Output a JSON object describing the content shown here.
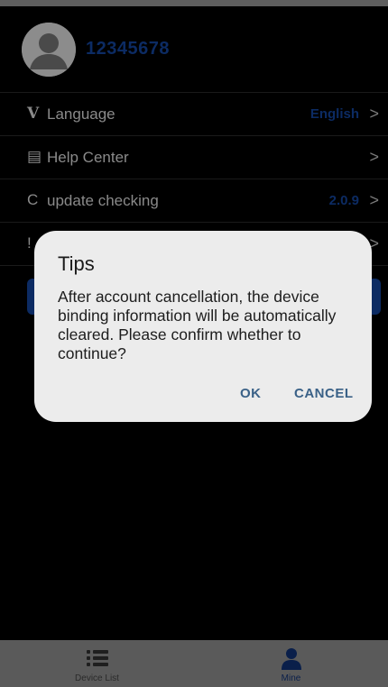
{
  "profile": {
    "username": "12345678"
  },
  "menu": [
    {
      "icon": "V",
      "label": "Language",
      "value": "English"
    },
    {
      "icon": "▤",
      "label": "Help Center",
      "value": ""
    },
    {
      "icon": "C",
      "label": "update checking",
      "value": "2.0.9"
    },
    {
      "icon": "!",
      "label": "",
      "value": ""
    }
  ],
  "chevron": ">",
  "dialog": {
    "title": "Tips",
    "message": "After account cancellation, the device binding information will be automatically cleared. Please confirm whether to continue?",
    "ok_label": "OK",
    "cancel_label": "CANCEL"
  },
  "tabs": [
    {
      "label": "Device List",
      "icon": "list-icon",
      "active": false
    },
    {
      "label": "Mine",
      "icon": "person-icon",
      "active": true
    }
  ],
  "colors": {
    "accent": "#0c2b63",
    "background": "#000000",
    "dialog": "#ececec",
    "dialog_button": "#3a6187",
    "tabbar": "#5a5a5a"
  }
}
